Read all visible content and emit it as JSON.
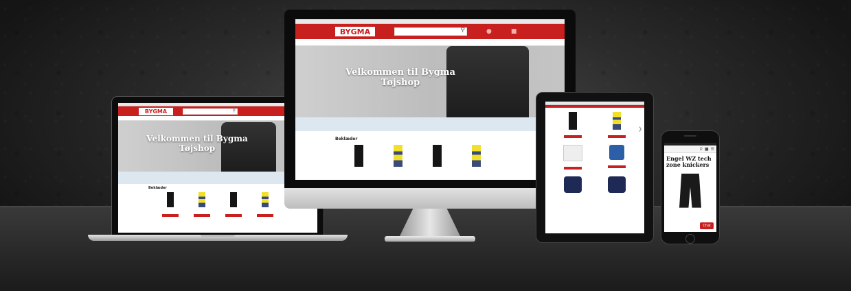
{
  "brand": {
    "name": "BYGMA",
    "color_primary": "#c8201f",
    "color_header": "#c8201f"
  },
  "hero": {
    "title_line1": "Velkommen til Bygma",
    "title_line2": "Tøjshop"
  },
  "section": {
    "title": "Beklæder"
  },
  "phone": {
    "product_title": "Engel WZ tech zone knickers",
    "chat_label": "Chat"
  },
  "icons": {
    "search": "search-icon",
    "cart": "cart-icon",
    "user": "user-icon",
    "menu": "menu-icon",
    "arrow": "chevron-right-icon"
  },
  "colors": {
    "accent": "#c8201f",
    "infobar": "#dde7f0",
    "hivis_yellow": "#f0e02a",
    "navy": "#3a4a7a"
  }
}
